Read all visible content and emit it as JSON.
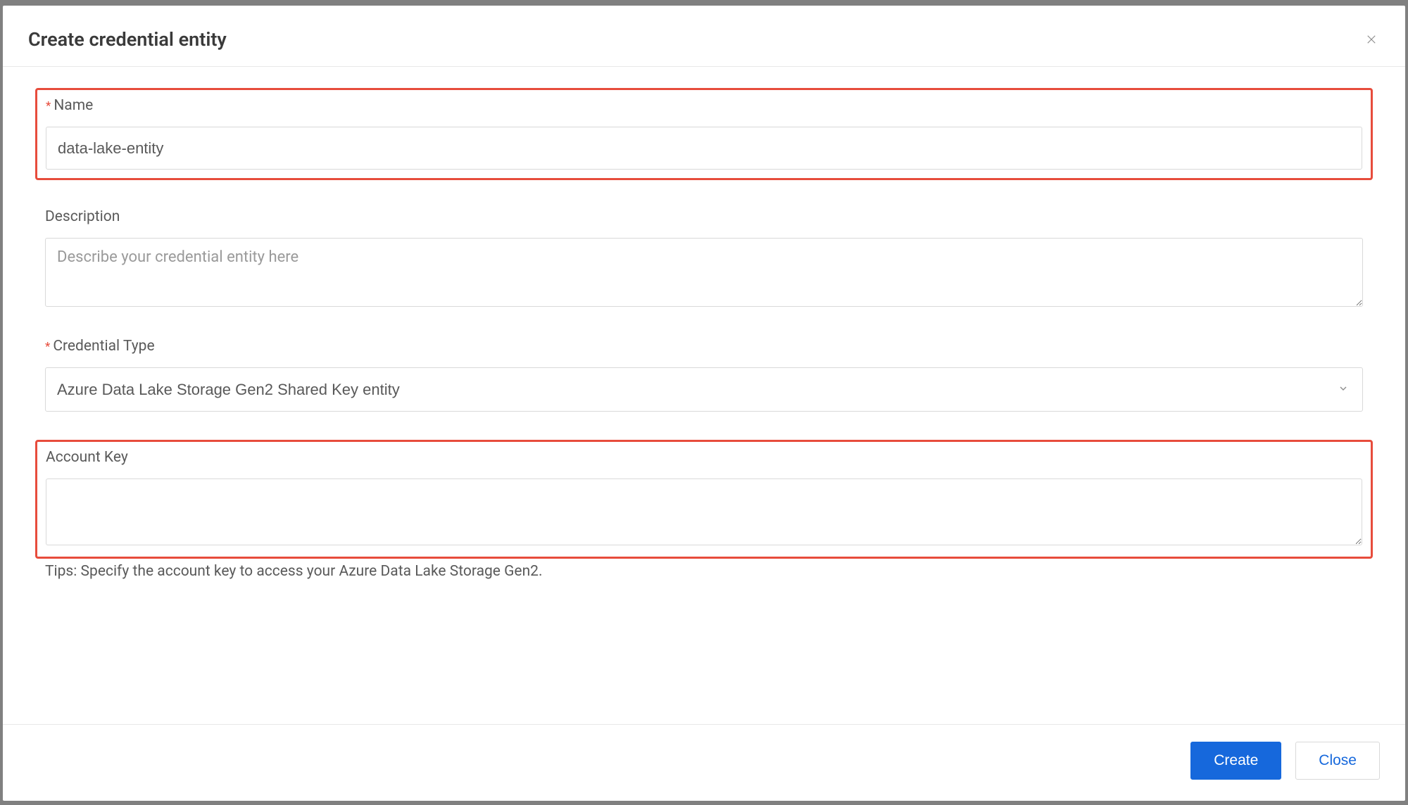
{
  "header": {
    "title": "Create credential entity"
  },
  "form": {
    "name": {
      "label": "Name",
      "value": "data-lake-entity"
    },
    "description": {
      "label": "Description",
      "placeholder": "Describe your credential entity here",
      "value": ""
    },
    "credential_type": {
      "label": "Credential Type",
      "selected": "Azure Data Lake Storage Gen2 Shared Key entity"
    },
    "account_key": {
      "label": "Account Key",
      "value": "",
      "tips": "Tips: Specify the account key to access your Azure Data Lake Storage Gen2."
    }
  },
  "footer": {
    "create_label": "Create",
    "close_label": "Close"
  }
}
